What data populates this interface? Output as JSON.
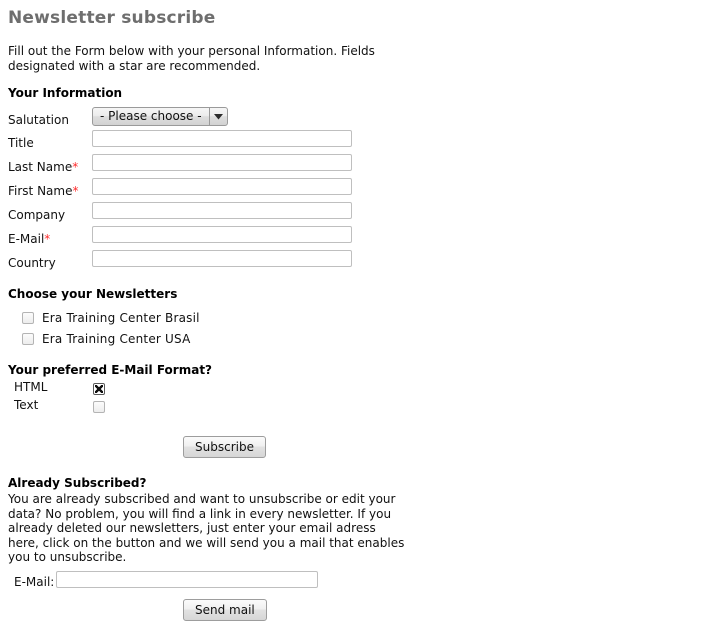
{
  "page": {
    "title": "Newsletter subscribe",
    "intro": "Fill out the Form below with your personal Information. Fields designated with a star are recommended."
  },
  "your_information": {
    "heading": "Your Information",
    "salutation": {
      "label": "Salutation",
      "selected": "- Please choose -",
      "arrow_icon": "chevron-down-icon"
    },
    "fields": [
      {
        "label": "Title",
        "required": false,
        "value": "",
        "placeholder": ""
      },
      {
        "label": "Last Name",
        "required": true,
        "value": "",
        "placeholder": ""
      },
      {
        "label": "First Name",
        "required": true,
        "value": "",
        "placeholder": ""
      },
      {
        "label": "Company",
        "required": false,
        "value": "",
        "placeholder": ""
      },
      {
        "label": "E-Mail",
        "required": true,
        "value": "",
        "placeholder": ""
      },
      {
        "label": "Country",
        "required": false,
        "value": "",
        "placeholder": ""
      }
    ],
    "required_marker": "*"
  },
  "newsletters": {
    "heading": "Choose your Newsletters",
    "options": [
      {
        "label": "Era Training Center Brasil",
        "checked": false
      },
      {
        "label": "Era Training Center USA",
        "checked": false
      }
    ]
  },
  "email_format": {
    "heading": "Your preferred E-Mail Format?",
    "options": [
      {
        "label": "HTML",
        "checked": true
      },
      {
        "label": "Text",
        "checked": false
      }
    ]
  },
  "subscribe_button": "Subscribe",
  "already_subscribed": {
    "heading": "Already Subscribed?",
    "text": "You are already subscribed and want to unsubscribe or edit your data? No problem, you will find a link in every newsletter. If you already deleted our newsletters, just enter your email adress here, click on the button and we will send you a mail that enables you to unsubscribe.",
    "email_label": "E-Mail:",
    "email_value": "",
    "email_placeholder": "",
    "send_button": "Send mail"
  },
  "colors": {
    "title": "#6e6e6e",
    "text": "#111111",
    "required_star": "#ff2a2a",
    "input_border": "#bfbfbf",
    "control_border": "#9d9d9d",
    "background": "#ffffff"
  }
}
